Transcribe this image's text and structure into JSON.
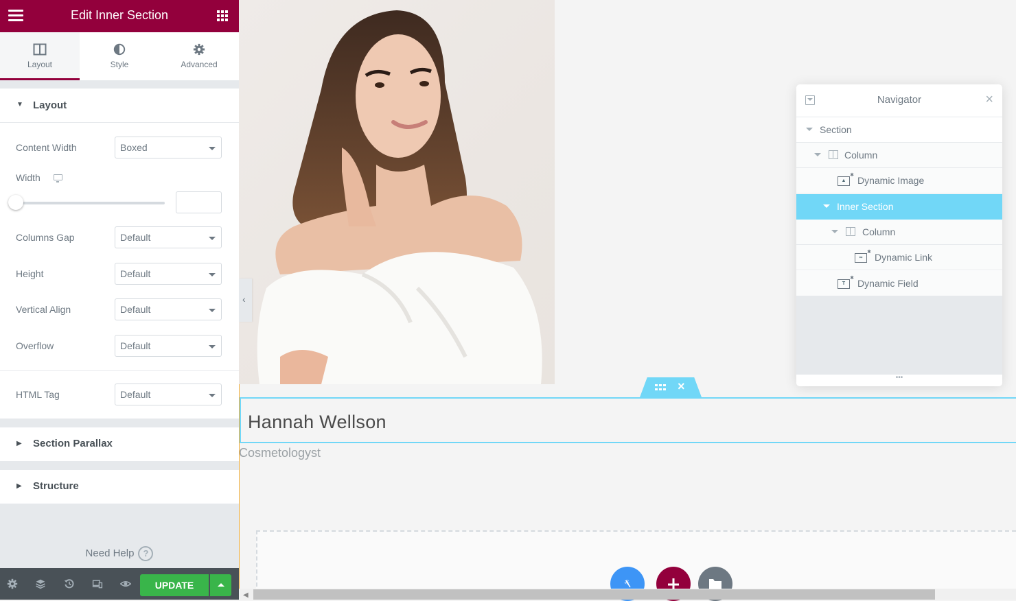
{
  "panel": {
    "title": "Edit Inner Section",
    "tabs": [
      {
        "label": "Layout",
        "icon": "columns-icon",
        "active": true
      },
      {
        "label": "Style",
        "icon": "half-circle-icon",
        "active": false
      },
      {
        "label": "Advanced",
        "icon": "gear-icon",
        "active": false
      }
    ],
    "layout_section": {
      "title": "Layout",
      "controls": {
        "content_width": {
          "label": "Content Width",
          "value": "Boxed"
        },
        "width": {
          "label": "Width",
          "value": "",
          "slider_percent": 0
        },
        "columns_gap": {
          "label": "Columns Gap",
          "value": "Default"
        },
        "height": {
          "label": "Height",
          "value": "Default"
        },
        "vertical_align": {
          "label": "Vertical Align",
          "value": "Default"
        },
        "overflow": {
          "label": "Overflow",
          "value": "Default"
        },
        "html_tag": {
          "label": "HTML Tag",
          "value": "Default"
        }
      }
    },
    "collapsed_sections": [
      "Section Parallax",
      "Structure"
    ],
    "need_help": "Need Help",
    "need_help_icon": "?",
    "footer": {
      "icons": [
        "settings-icon",
        "navigator-layers-icon",
        "history-icon",
        "responsive-icon",
        "preview-eye-icon"
      ],
      "update_label": "UPDATE"
    }
  },
  "canvas": {
    "name": "Hannah Wellson",
    "role": "Cosmetologyst",
    "photo_alt": "woman in white bathrobe"
  },
  "navigator": {
    "title": "Navigator",
    "items": [
      {
        "label": "Section",
        "type": "section",
        "selected": false
      },
      {
        "label": "Column",
        "type": "column",
        "selected": false
      },
      {
        "label": "Dynamic Image",
        "type": "widget",
        "selected": false
      },
      {
        "label": "Inner Section",
        "type": "section",
        "selected": true
      },
      {
        "label": "Column",
        "type": "column",
        "selected": false
      },
      {
        "label": "Dynamic Link",
        "type": "widget",
        "selected": false
      },
      {
        "label": "Dynamic Field",
        "type": "widget",
        "selected": false
      }
    ],
    "resize_handle": "•••"
  },
  "colors": {
    "brand": "#93003c",
    "update": "#39b54a",
    "selection": "#71d7f7",
    "fab_magic": "#3d95f6",
    "fab_add": "#93003c",
    "fab_template": "#6d7882"
  }
}
